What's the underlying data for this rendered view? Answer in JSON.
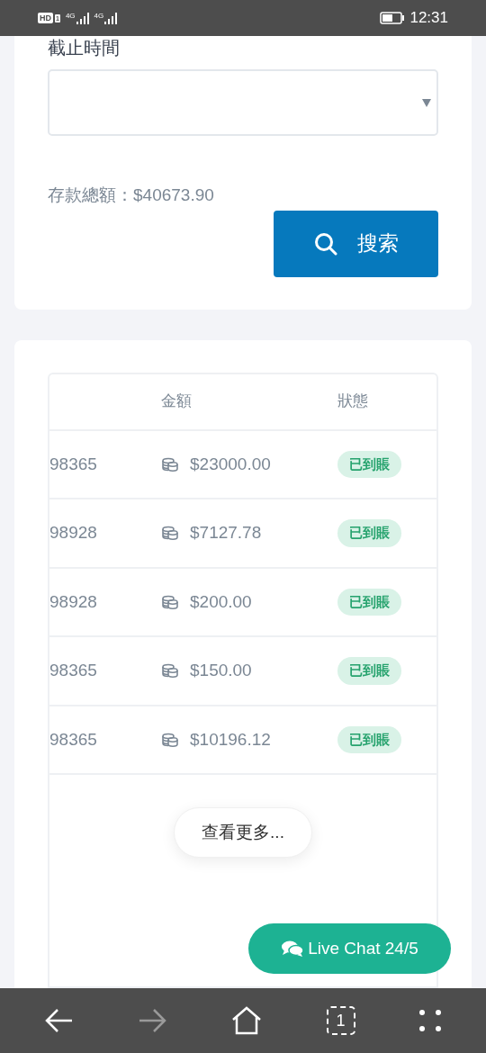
{
  "status_bar": {
    "network": "HD",
    "sim": "1",
    "signals": [
      "4G",
      "4G"
    ],
    "time": "12:31"
  },
  "filter": {
    "deadline_label": "截止時間",
    "total": "存款總額：$40673.90",
    "search_button": "搜索"
  },
  "table": {
    "columns": [
      "金額",
      "狀態"
    ],
    "rows": [
      {
        "column_1": "98365",
        "amount": "$23000.00",
        "status": "已到賬"
      },
      {
        "column_1": "98928",
        "amount": "$7127.78",
        "status": "已到賬"
      },
      {
        "column_1": "98928",
        "amount": "$200.00",
        "status": "已到賬"
      },
      {
        "column_1": "98365",
        "amount": "$150.00",
        "status": "已到賬"
      },
      {
        "column_1": "98365",
        "amount": "$10196.12",
        "status": "已到賬"
      }
    ]
  },
  "load_more": "查看更多...",
  "live_chat": "Live Chat 24/5",
  "browser_bar": {
    "back": {
      "disabled": false
    },
    "forward": {
      "disabled": true
    },
    "tab_count": "1"
  }
}
